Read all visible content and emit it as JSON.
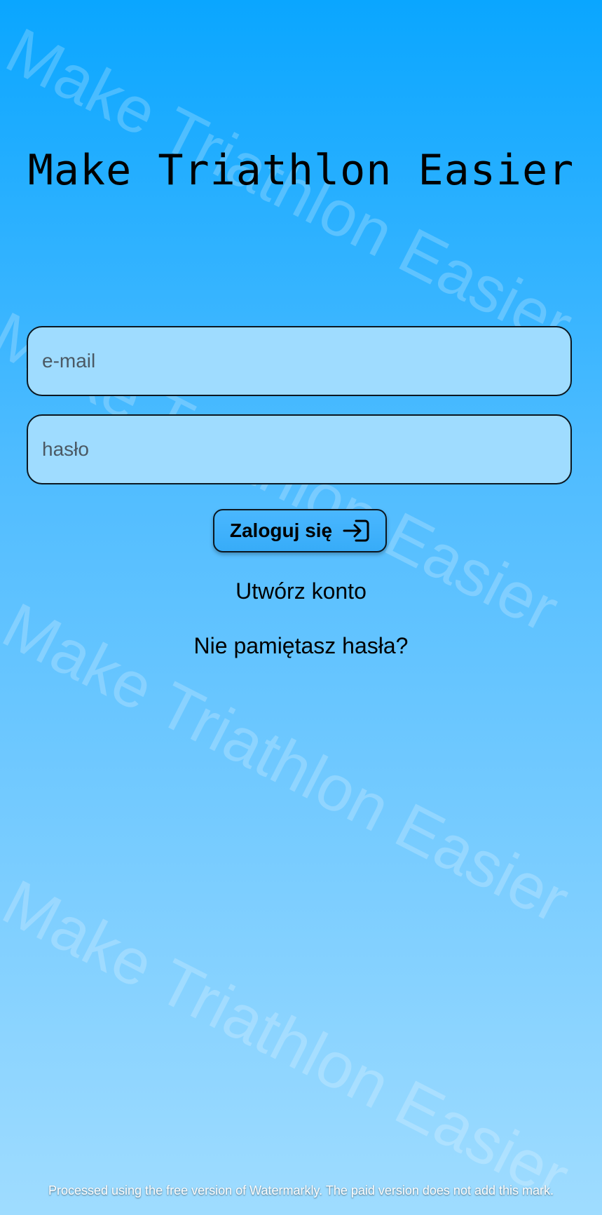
{
  "app": {
    "title": "Make Triathlon Easier"
  },
  "form": {
    "email": {
      "value": "",
      "placeholder": "e-mail"
    },
    "password": {
      "value": "",
      "placeholder": "hasło"
    },
    "login_label": "Zaloguj się",
    "login_icon": "login-icon"
  },
  "links": {
    "register": "Utwórz konto",
    "forgot_password": "Nie pamiętasz hasła?"
  },
  "watermark": {
    "text": "Make Triathlon Easier",
    "footer": "Processed using the free version of Watermarkly. The paid version does not add this mark."
  },
  "colors": {
    "gradient_top": "#0aa6ff",
    "gradient_bottom": "#9fdcff",
    "field_bg": "#9fdcff",
    "button_bg": "#3fb0fb"
  }
}
